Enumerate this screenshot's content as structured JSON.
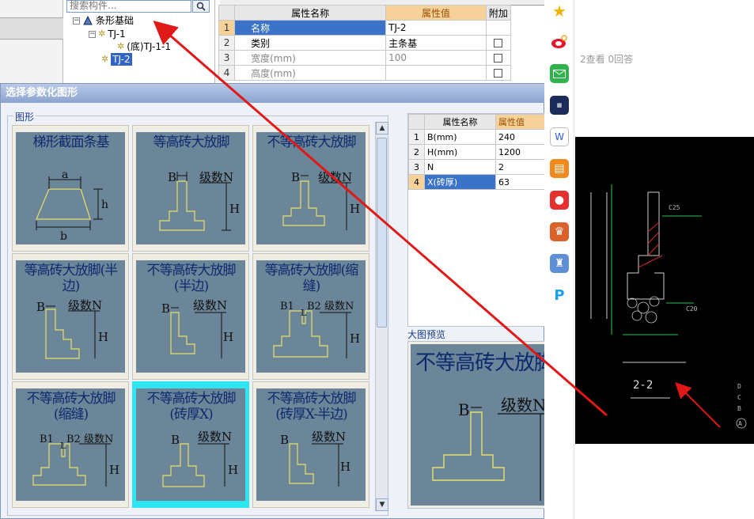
{
  "tree": {
    "search_placeholder": "搜索构件...",
    "nodes": [
      {
        "label": "条形基础"
      },
      {
        "label": "TJ-1"
      },
      {
        "label": "(底)TJ-1-1"
      },
      {
        "label": "TJ-2"
      }
    ]
  },
  "property_panel": {
    "header_name": "属性名称",
    "header_value": "属性值",
    "header_extra": "附加",
    "rows": [
      {
        "index": "1",
        "name": "名称",
        "value": "TJ-2"
      },
      {
        "index": "2",
        "name": "类别",
        "value": "主条基"
      },
      {
        "index": "3",
        "name": "宽度(mm)",
        "value": "100"
      },
      {
        "index": "4",
        "name": "高度(mm)",
        "value": ""
      }
    ]
  },
  "dialog": {
    "title": "选择参数化图形",
    "shapes_legend": "图形",
    "shapes": [
      {
        "caption": "梯形截面条基"
      },
      {
        "caption": "等高砖大放脚"
      },
      {
        "caption": "不等高砖大放脚"
      },
      {
        "caption": "等高砖大放脚(半边)"
      },
      {
        "caption": "不等高砖大放脚(半边)"
      },
      {
        "caption": "等高砖大放脚(缩缝)"
      },
      {
        "caption": "不等高砖大放脚(缩缝)"
      },
      {
        "caption": "不等高砖大放脚(砖厚X)"
      },
      {
        "caption": "不等高砖大放脚(砖厚X-半边)"
      }
    ],
    "diagram_labels": {
      "a": "a",
      "b": "b",
      "h": "h",
      "B": "B",
      "H": "H",
      "N": "级数N",
      "B1": "B1",
      "B2": "B2",
      "L": "L"
    },
    "param_table": {
      "header_name": "属性名称",
      "header_value": "属性值",
      "rows": [
        {
          "index": "1",
          "name": "B(mm)",
          "value": "240"
        },
        {
          "index": "2",
          "name": "H(mm)",
          "value": "1200"
        },
        {
          "index": "3",
          "name": "N",
          "value": "2"
        },
        {
          "index": "4",
          "name": "X(砖厚)",
          "value": "63"
        }
      ]
    },
    "preview_legend": "大图预览",
    "preview_title": "不等高砖大放脚(砖厚X)"
  },
  "right_page": {
    "stats": "2查看  0回答",
    "section_label": "2-2",
    "side_icons": [
      "star-icon",
      "weibo-icon",
      "mail-icon",
      "news-icon",
      "doc-icon",
      "novel-icon",
      "red-icon",
      "game-icon",
      "game2-icon",
      "p-icon"
    ]
  },
  "colors": {
    "selection": "#3a73c8",
    "tile_bg": "#6b8599",
    "diagram_line": "#e9e06a",
    "annotation_arrow": "#e01818"
  }
}
